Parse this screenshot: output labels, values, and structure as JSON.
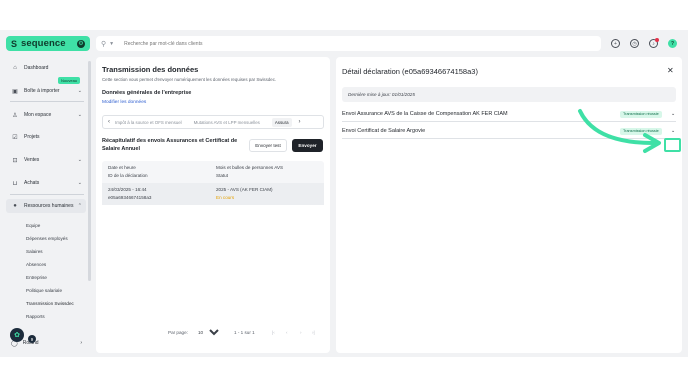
{
  "brand": {
    "name": "sequence",
    "mark": "S"
  },
  "search": {
    "placeholder": "Recherche par mot-clé dans clients"
  },
  "topbar": {
    "icons": [
      "add-icon",
      "clock-icon",
      "bell-icon",
      "help-icon"
    ],
    "help_label": "?"
  },
  "sidebar": {
    "items": [
      {
        "label": "Dashboard",
        "icon": "home-icon"
      },
      {
        "label": "Boîte à importer",
        "icon": "inbox-icon",
        "badge": "Nouveau"
      },
      {
        "label": "Mon espace",
        "icon": "person-icon"
      },
      {
        "label": "Projets",
        "icon": "check-icon"
      },
      {
        "label": "Ventes",
        "icon": "lock-icon"
      },
      {
        "label": "Achats",
        "icon": "bag-icon"
      },
      {
        "label": "Ressources humaines",
        "icon": "person-icon"
      }
    ],
    "sub_items": [
      "Equipe",
      "Dépenses employés",
      "Salaires",
      "Absences",
      "Entreprise",
      "Politique salariale",
      "Transmission Swissdec",
      "Rapports"
    ],
    "user": {
      "label": "Roland"
    },
    "helper_count": "9"
  },
  "middle": {
    "title": "Transmission des données",
    "description": "Cette section vous permet d'envoyer numériquement les données requises par Swissdec.",
    "section": "Données générales de l'entreprise",
    "link": "Modifier les données",
    "tabs": [
      "Impôt à la source et OFS mensuel",
      "Mutations AVS et LPP mensuelles",
      "Assura"
    ],
    "recap_title": "Récapitulatif des envois Assurances et Certificat de Salaire Annuel",
    "btn_test": "Envoyer test",
    "btn_send": "Envoyer",
    "table": {
      "headers": [
        [
          "Date et heure",
          "ID de la déclaration"
        ],
        [
          "Mois et bulles de personnes AVS",
          "Statut"
        ]
      ],
      "row": {
        "date": "24/03/2025 - 16:44",
        "id": "e05a69346674158a3",
        "period": "2025 - AVS (AK FER CIAM)",
        "status": "En cours"
      }
    },
    "pager": {
      "per_page_label": "Par page:",
      "per_page": "10",
      "range": "1 - 1 sur 1",
      "nav": [
        "|‹",
        "‹",
        "›",
        "›|"
      ]
    }
  },
  "right": {
    "title": "Détail déclaration (e05a69346674158a3)",
    "last_update": "Dernière mise à jour: 01/01/2025",
    "rows": [
      {
        "label": "Envoi Assurance AVS de la Caisse de Compensation AK FER CIAM",
        "status": "Transmission réussie"
      },
      {
        "label": "Envoi Certificat de Salaire Argovie",
        "status": "Transmission réussie"
      }
    ]
  },
  "colors": {
    "accent": "#3fe0a6",
    "dark": "#1f2329",
    "pending": "#e5a100"
  }
}
